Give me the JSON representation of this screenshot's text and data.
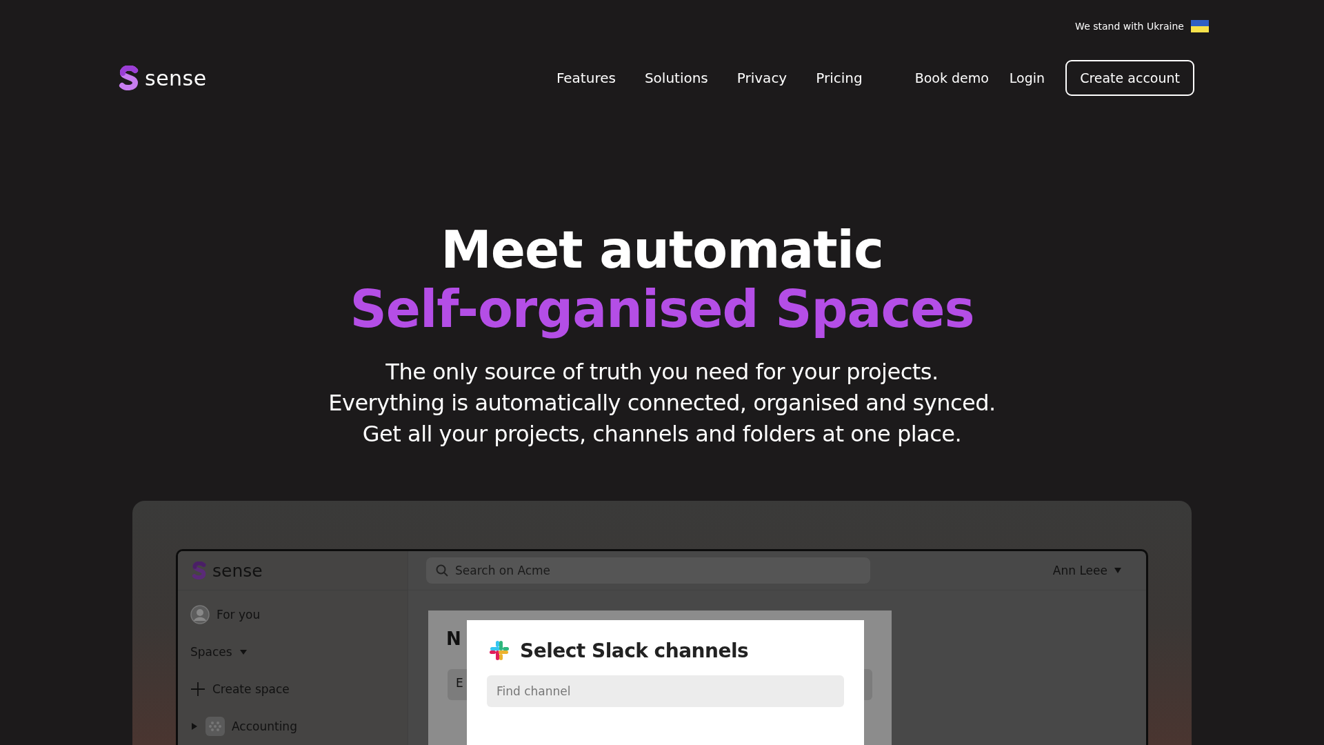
{
  "top_bar": {
    "text": "We stand with Ukraine"
  },
  "nav": {
    "logo": "sense",
    "links": [
      "Features",
      "Solutions",
      "Privacy",
      "Pricing"
    ],
    "actions": [
      {
        "label": "Book demo",
        "kind": "link"
      },
      {
        "label": "Login",
        "kind": "link"
      },
      {
        "label": "Create account",
        "kind": "outlined"
      }
    ]
  },
  "hero": {
    "title": "Meet automatic",
    "highlight": "Self-organised Spaces",
    "subtitle_lines": [
      "The only source of truth you need for your projects.",
      "Everything is automatically connected, organised and synced.",
      "Get all your projects, channels and folders at one place."
    ]
  },
  "app_preview": {
    "logo": "sense",
    "search": {
      "placeholder": "Search on Acme"
    },
    "user": "Ann Leee",
    "sidebar": {
      "items": [
        {
          "kind": "profile",
          "label": "For you"
        },
        {
          "kind": "section",
          "label": "Spaces",
          "expanded": true
        },
        {
          "kind": "action",
          "label": "Create space"
        },
        {
          "kind": "space",
          "label": "Accounting",
          "expanded": false
        }
      ]
    },
    "background_page": {
      "heading": "N",
      "field_text": "E"
    },
    "modal": {
      "title": "Select Slack channels",
      "search": {
        "placeholder": "Find channel"
      }
    }
  }
}
